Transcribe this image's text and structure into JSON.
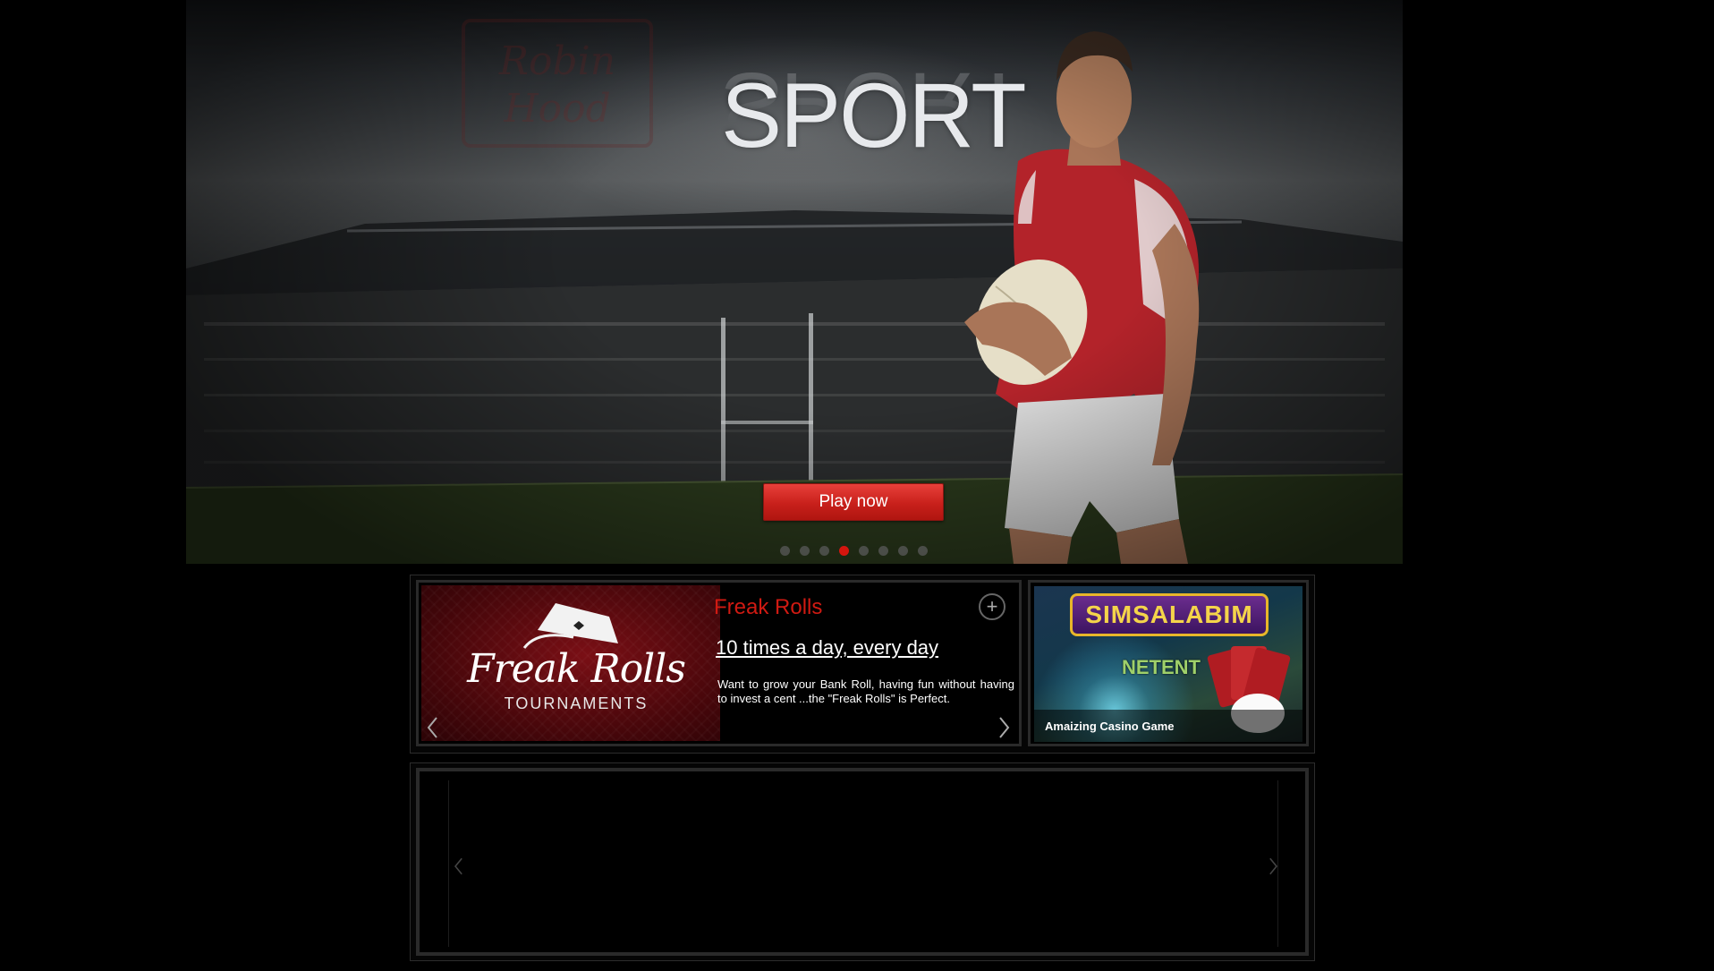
{
  "hero": {
    "title": "SPORT",
    "play_label": "Play now",
    "brand_icon": "robin-hood-logo-watermark",
    "slides_total": 8,
    "active_slide": 4
  },
  "promo": {
    "banner": {
      "logo_text": "Freak Rolls",
      "logo_subtext": "TOURNAMENTS"
    },
    "title": "Freak Rolls",
    "subtitle": "10 times a day, every day",
    "description": "Want to grow your Bank Roll, having fun without having to invest a cent ...the \"Freak Rolls\" is Perfect.",
    "plus_icon": "plus-circle-icon",
    "prev_icon": "chevron-left-icon",
    "next_icon": "chevron-right-icon"
  },
  "game": {
    "logo_text": "SIMSALABIM",
    "provider_text": "NETENT",
    "caption": "Amaizing Casino Game"
  },
  "bottom_carousel": {
    "prev_icon": "chevron-left-icon",
    "next_icon": "chevron-right-icon"
  },
  "colors": {
    "accent_red": "#d5150e",
    "background": "#000000",
    "dot_inactive": "#5a5a5a"
  }
}
